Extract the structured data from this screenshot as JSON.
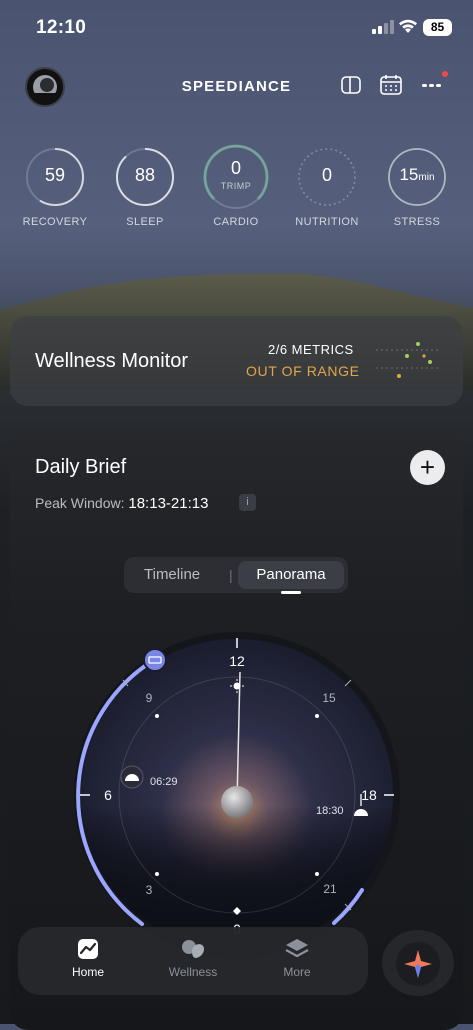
{
  "status_bar": {
    "time": "12:10",
    "battery": "85"
  },
  "header": {
    "brand": "SPEEDIANCE"
  },
  "metrics": [
    {
      "value": "59",
      "unit": "",
      "sub": "",
      "label": "RECOVERY",
      "progress": 0.59
    },
    {
      "value": "88",
      "unit": "",
      "sub": "",
      "label": "SLEEP",
      "progress": 0.88
    },
    {
      "value": "0",
      "unit": "",
      "sub": "TRIMP",
      "label": "CARDIO",
      "progress": 0
    },
    {
      "value": "0",
      "unit": "",
      "sub": "",
      "label": "NUTRITION",
      "progress": 0
    },
    {
      "value": "15",
      "unit": "min",
      "sub": "",
      "label": "STRESS",
      "progress": 0.15
    }
  ],
  "wellness_monitor": {
    "title": "Wellness Monitor",
    "metrics_count": "2/6 METRICS",
    "status": "OUT OF RANGE",
    "accent_color": "#e1a64a"
  },
  "daily_brief": {
    "title": "Daily Brief",
    "add_label": "+",
    "peak_label": "Peak Window:",
    "peak_value": "18:13-21:13",
    "info_label": "i",
    "tabs": [
      {
        "label": "Timeline"
      },
      {
        "label": "Panorama"
      }
    ],
    "active_tab": "Panorama",
    "clock": {
      "hour_labels": [
        "12",
        "15",
        "18",
        "21",
        "0",
        "3",
        "6",
        "9"
      ],
      "sunrise_time": "06:29",
      "sunset_time": "18:30"
    }
  },
  "bottom_nav": {
    "items": [
      {
        "label": "Home",
        "icon": "chart-icon",
        "active": true
      },
      {
        "label": "Wellness",
        "icon": "wellness-icon",
        "active": false
      },
      {
        "label": "More",
        "icon": "layers-icon",
        "active": false
      }
    ]
  },
  "colors": {
    "ring_accent": "#9aa6ff",
    "brand_star": "#ef7a5a"
  }
}
